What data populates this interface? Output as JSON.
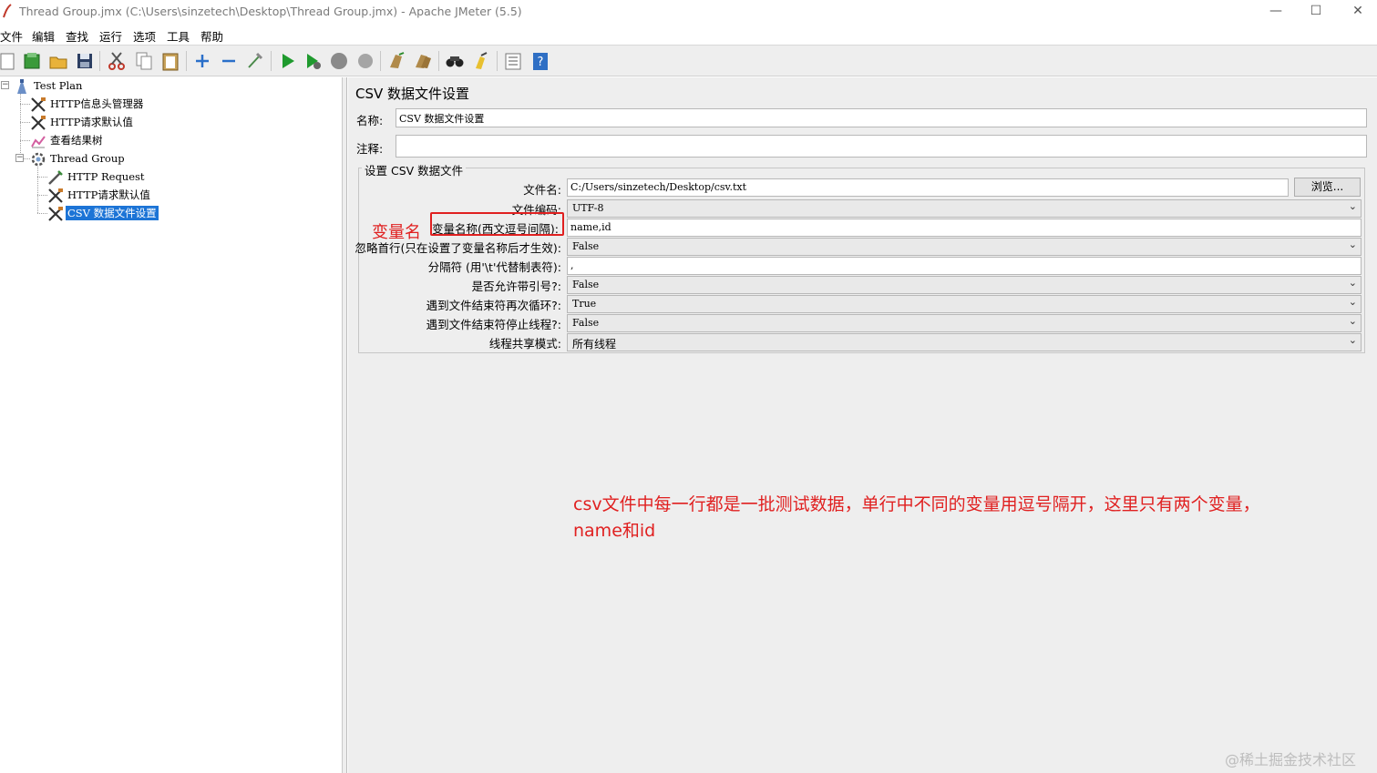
{
  "window": {
    "title": "Thread Group.jmx (C:\\Users\\sinzetech\\Desktop\\Thread Group.jmx) - Apache JMeter (5.5)",
    "minimize": "—",
    "maximize": "☐",
    "close": "✕"
  },
  "menu": [
    "文件",
    "编辑",
    "查找",
    "运行",
    "选项",
    "工具",
    "帮助"
  ],
  "toolbar_icons": [
    "new-icon",
    "templates-icon",
    "open-icon",
    "save-icon",
    "cut-icon",
    "copy-icon",
    "paste-icon",
    "expand-icon",
    "collapse-icon",
    "toggle-icon",
    "start-icon",
    "start-no-pauses-icon",
    "stop-icon",
    "shutdown-icon",
    "clear-icon",
    "clear-all-icon",
    "search-icon",
    "reset-search-icon",
    "function-helper-icon",
    "help-icon"
  ],
  "tree": {
    "nodes": [
      {
        "label": "Test Plan",
        "icon": "test-plan-icon"
      },
      {
        "label": "HTTP信息头管理器",
        "icon": "config-element-icon"
      },
      {
        "label": "HTTP请求默认值",
        "icon": "config-element-icon"
      },
      {
        "label": "查看结果树",
        "icon": "listener-icon"
      },
      {
        "label": "Thread Group",
        "icon": "thread-group-icon"
      },
      {
        "label": "HTTP Request",
        "icon": "sampler-icon"
      },
      {
        "label": "HTTP请求默认值",
        "icon": "config-element-icon"
      },
      {
        "label": "CSV 数据文件设置",
        "icon": "config-element-icon",
        "selected": true
      }
    ]
  },
  "panel": {
    "title": "CSV 数据文件设置",
    "name_label": "名称:",
    "name_value": "CSV 数据文件设置",
    "comment_label": "注释:",
    "comment_value": "",
    "group_title": "设置 CSV 数据文件",
    "filename_label": "文件名:",
    "filename_value": "C:/Users/sinzetech/Desktop/csv.txt",
    "browse_label": "浏览...",
    "encoding_label": "文件编码:",
    "encoding_value": "UTF-8",
    "varnames_label": "变量名称(西文逗号间隔):",
    "varnames_value": "name,id",
    "ignore_first_label": "忽略首行(只在设置了变量名称后才生效):",
    "ignore_first_value": "False",
    "delimiter_label": "分隔符 (用'\\t'代替制表符):",
    "delimiter_value": ",",
    "quoted_label": "是否允许带引号?:",
    "quoted_value": "False",
    "recycle_label": "遇到文件结束符再次循环?:",
    "recycle_value": "True",
    "stop_thread_label": "遇到文件结束符停止线程?:",
    "stop_thread_value": "False",
    "share_mode_label": "线程共享模式:",
    "share_mode_value": "所有线程"
  },
  "annotations": {
    "varname_tag": "变量名",
    "note_line1": "csv文件中每一行都是一批测试数据，单行中不同的变量用逗号隔开，这里只有两个变量，",
    "note_line2": "name和id",
    "color": "#e02020"
  },
  "watermark": "@稀土掘金技术社区",
  "colors": {
    "selection": "#1c74d6",
    "panel_bg": "#eeeeee"
  }
}
